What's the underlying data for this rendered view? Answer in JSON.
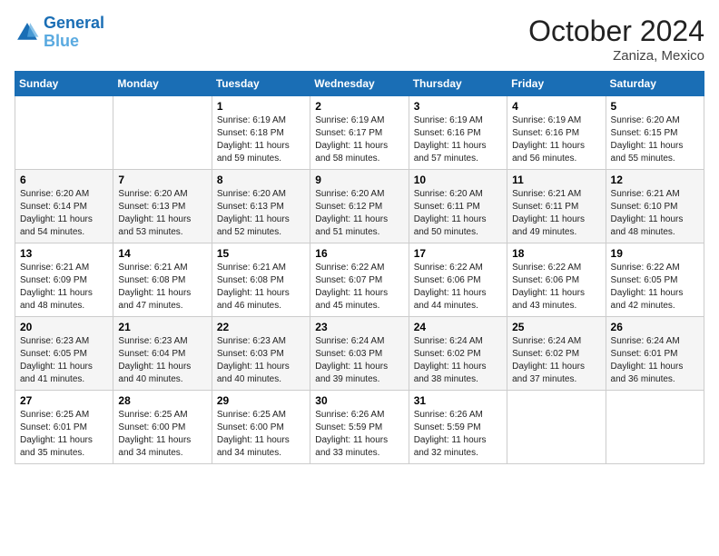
{
  "header": {
    "logo_line1": "General",
    "logo_line2": "Blue",
    "month_year": "October 2024",
    "location": "Zaniza, Mexico"
  },
  "days_of_week": [
    "Sunday",
    "Monday",
    "Tuesday",
    "Wednesday",
    "Thursday",
    "Friday",
    "Saturday"
  ],
  "weeks": [
    [
      null,
      null,
      {
        "day": "1",
        "sunrise": "6:19 AM",
        "sunset": "6:18 PM",
        "daylight": "11 hours and 59 minutes."
      },
      {
        "day": "2",
        "sunrise": "6:19 AM",
        "sunset": "6:17 PM",
        "daylight": "11 hours and 58 minutes."
      },
      {
        "day": "3",
        "sunrise": "6:19 AM",
        "sunset": "6:16 PM",
        "daylight": "11 hours and 57 minutes."
      },
      {
        "day": "4",
        "sunrise": "6:19 AM",
        "sunset": "6:16 PM",
        "daylight": "11 hours and 56 minutes."
      },
      {
        "day": "5",
        "sunrise": "6:20 AM",
        "sunset": "6:15 PM",
        "daylight": "11 hours and 55 minutes."
      }
    ],
    [
      {
        "day": "6",
        "sunrise": "6:20 AM",
        "sunset": "6:14 PM",
        "daylight": "11 hours and 54 minutes."
      },
      {
        "day": "7",
        "sunrise": "6:20 AM",
        "sunset": "6:13 PM",
        "daylight": "11 hours and 53 minutes."
      },
      {
        "day": "8",
        "sunrise": "6:20 AM",
        "sunset": "6:13 PM",
        "daylight": "11 hours and 52 minutes."
      },
      {
        "day": "9",
        "sunrise": "6:20 AM",
        "sunset": "6:12 PM",
        "daylight": "11 hours and 51 minutes."
      },
      {
        "day": "10",
        "sunrise": "6:20 AM",
        "sunset": "6:11 PM",
        "daylight": "11 hours and 50 minutes."
      },
      {
        "day": "11",
        "sunrise": "6:21 AM",
        "sunset": "6:11 PM",
        "daylight": "11 hours and 49 minutes."
      },
      {
        "day": "12",
        "sunrise": "6:21 AM",
        "sunset": "6:10 PM",
        "daylight": "11 hours and 48 minutes."
      }
    ],
    [
      {
        "day": "13",
        "sunrise": "6:21 AM",
        "sunset": "6:09 PM",
        "daylight": "11 hours and 48 minutes."
      },
      {
        "day": "14",
        "sunrise": "6:21 AM",
        "sunset": "6:08 PM",
        "daylight": "11 hours and 47 minutes."
      },
      {
        "day": "15",
        "sunrise": "6:21 AM",
        "sunset": "6:08 PM",
        "daylight": "11 hours and 46 minutes."
      },
      {
        "day": "16",
        "sunrise": "6:22 AM",
        "sunset": "6:07 PM",
        "daylight": "11 hours and 45 minutes."
      },
      {
        "day": "17",
        "sunrise": "6:22 AM",
        "sunset": "6:06 PM",
        "daylight": "11 hours and 44 minutes."
      },
      {
        "day": "18",
        "sunrise": "6:22 AM",
        "sunset": "6:06 PM",
        "daylight": "11 hours and 43 minutes."
      },
      {
        "day": "19",
        "sunrise": "6:22 AM",
        "sunset": "6:05 PM",
        "daylight": "11 hours and 42 minutes."
      }
    ],
    [
      {
        "day": "20",
        "sunrise": "6:23 AM",
        "sunset": "6:05 PM",
        "daylight": "11 hours and 41 minutes."
      },
      {
        "day": "21",
        "sunrise": "6:23 AM",
        "sunset": "6:04 PM",
        "daylight": "11 hours and 40 minutes."
      },
      {
        "day": "22",
        "sunrise": "6:23 AM",
        "sunset": "6:03 PM",
        "daylight": "11 hours and 40 minutes."
      },
      {
        "day": "23",
        "sunrise": "6:24 AM",
        "sunset": "6:03 PM",
        "daylight": "11 hours and 39 minutes."
      },
      {
        "day": "24",
        "sunrise": "6:24 AM",
        "sunset": "6:02 PM",
        "daylight": "11 hours and 38 minutes."
      },
      {
        "day": "25",
        "sunrise": "6:24 AM",
        "sunset": "6:02 PM",
        "daylight": "11 hours and 37 minutes."
      },
      {
        "day": "26",
        "sunrise": "6:24 AM",
        "sunset": "6:01 PM",
        "daylight": "11 hours and 36 minutes."
      }
    ],
    [
      {
        "day": "27",
        "sunrise": "6:25 AM",
        "sunset": "6:01 PM",
        "daylight": "11 hours and 35 minutes."
      },
      {
        "day": "28",
        "sunrise": "6:25 AM",
        "sunset": "6:00 PM",
        "daylight": "11 hours and 34 minutes."
      },
      {
        "day": "29",
        "sunrise": "6:25 AM",
        "sunset": "6:00 PM",
        "daylight": "11 hours and 34 minutes."
      },
      {
        "day": "30",
        "sunrise": "6:26 AM",
        "sunset": "5:59 PM",
        "daylight": "11 hours and 33 minutes."
      },
      {
        "day": "31",
        "sunrise": "6:26 AM",
        "sunset": "5:59 PM",
        "daylight": "11 hours and 32 minutes."
      },
      null,
      null
    ]
  ]
}
